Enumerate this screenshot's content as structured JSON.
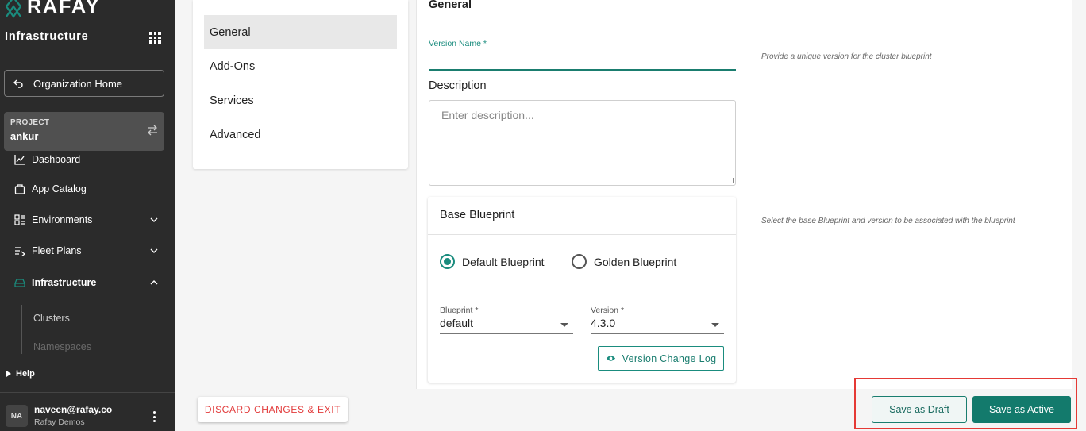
{
  "brand": {
    "logo_text": "RAFAY",
    "app_title": "Infrastructure",
    "accent_color": "#1a8c7e"
  },
  "sidebar": {
    "org_home": "Organization Home",
    "project": {
      "label": "PROJECT",
      "name": "ankur"
    },
    "items": [
      {
        "label": "Dashboard",
        "icon": "chart-icon"
      },
      {
        "label": "App Catalog",
        "icon": "catalog-icon"
      },
      {
        "label": "Environments",
        "icon": "environments-icon"
      },
      {
        "label": "Fleet Plans",
        "icon": "fleet-plans-icon"
      },
      {
        "label": "Infrastructure",
        "icon": "infrastructure-icon"
      }
    ],
    "sub_items": [
      "Clusters",
      "Namespaces"
    ],
    "help": "Help",
    "user": {
      "initials": "NA",
      "email": "naveen@rafay.co",
      "org": "Rafay Demos"
    }
  },
  "tabs": [
    "General",
    "Add-Ons",
    "Services",
    "Advanced"
  ],
  "form": {
    "section_title": "General",
    "version_name_label": "Version Name *",
    "version_name_hint": "Provide a unique version for the cluster blueprint",
    "description_label": "Description",
    "description_placeholder": "Enter description...",
    "base_blueprint": {
      "title": "Base Blueprint",
      "hint": "Select the base Blueprint and version to be associated with the blueprint",
      "option_default": "Default Blueprint",
      "option_golden": "Golden Blueprint",
      "blueprint_label": "Blueprint *",
      "blueprint_value": "default",
      "version_label": "Version *",
      "version_value": "4.3.0",
      "change_log_button": "Version Change Log"
    }
  },
  "footer": {
    "discard": "DISCARD CHANGES & EXIT",
    "save_draft": "Save as Draft",
    "save_active": "Save as Active"
  }
}
